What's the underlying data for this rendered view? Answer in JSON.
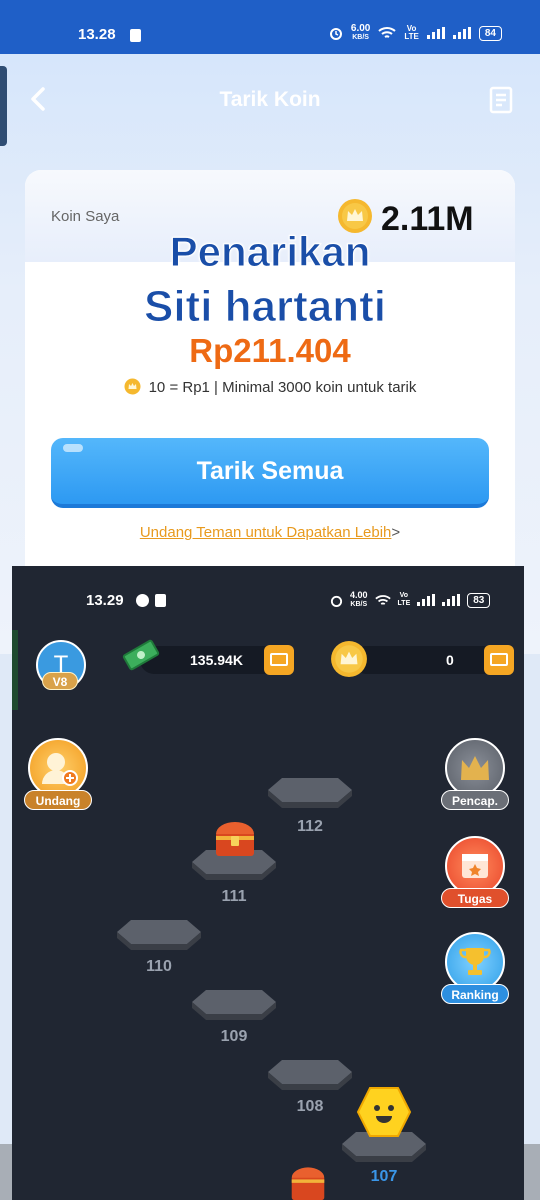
{
  "status1": {
    "time": "13.28",
    "speed_top": "6.00",
    "speed_unit": "KB/S",
    "volte_top": "Vo",
    "volte_bottom": "LTE",
    "battery": "84"
  },
  "header": {
    "title": "Tarik Koin"
  },
  "card": {
    "koin_label": "Koin Saya",
    "balance": "2.11M",
    "overlay_line1": "Penarikan",
    "overlay_line2": "Siti hartanti",
    "amount": "Rp211.404",
    "rate_text": "10 = Rp1 | Minimal 3000 koin untuk tarik",
    "withdraw_button": "Tarik Semua",
    "invite_link": "Undang Teman untuk Dapatkan Lebih",
    "invite_arrow": ">"
  },
  "game": {
    "status": {
      "time": "13.29",
      "speed_top": "4.00",
      "speed_unit": "KB/S",
      "volte_top": "Vo",
      "volte_bottom": "LTE",
      "battery": "83"
    },
    "avatar_letter": "T",
    "vip_level": "V8",
    "cash_balance": "135.94K",
    "coin_balance": "0",
    "side_buttons": {
      "invite": "Undang",
      "achievement": "Pencap.",
      "task": "Tugas",
      "ranking": "Ranking"
    },
    "levels": [
      "112",
      "111",
      "110",
      "109",
      "108",
      "107"
    ],
    "current_level": "107"
  },
  "colors": {
    "brand_blue": "#1f5fc7",
    "button_blue": "#2d99f2",
    "orange": "#ee6a14",
    "gold": "#f5b82e",
    "game_bg": "#202632"
  }
}
